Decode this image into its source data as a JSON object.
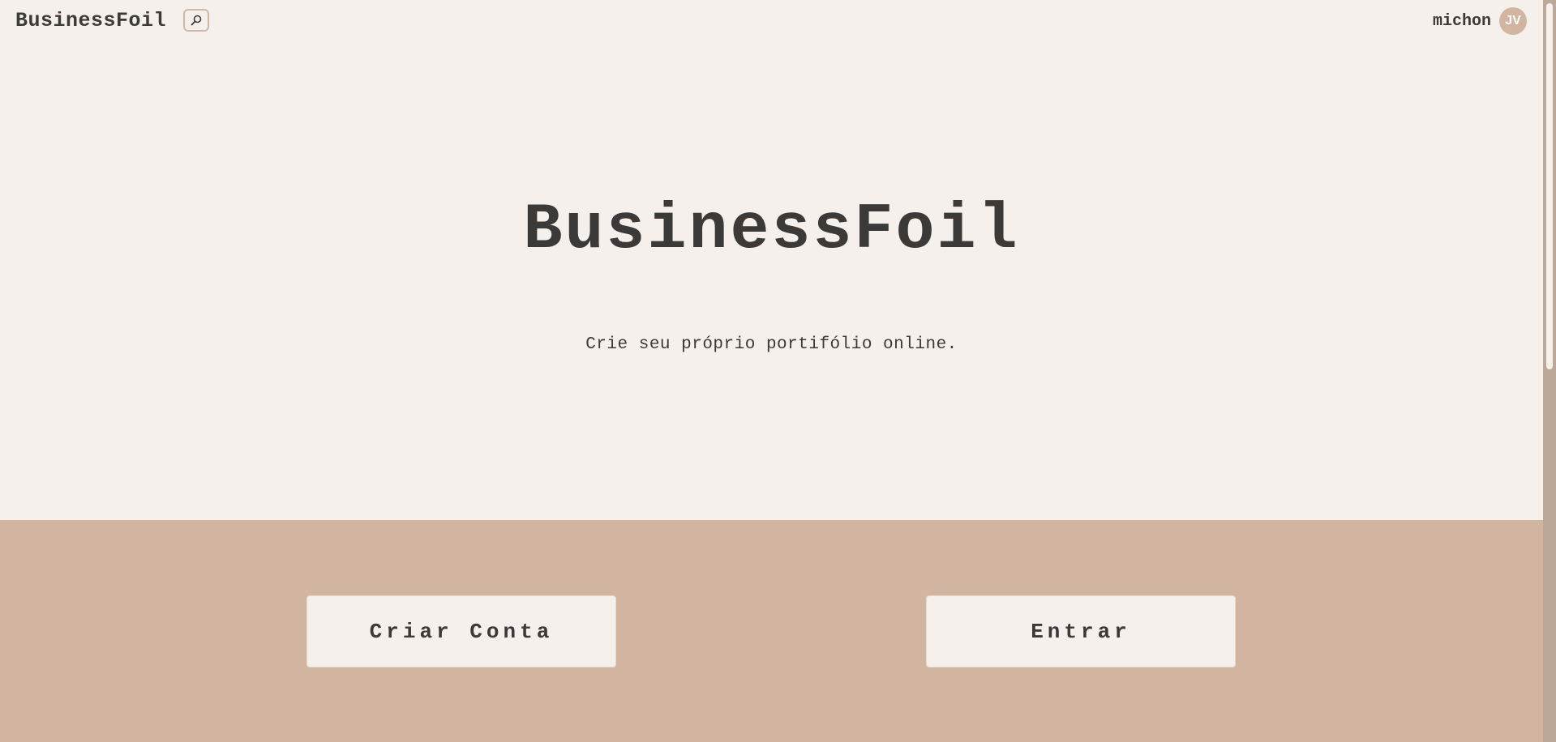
{
  "header": {
    "brand": "BusinessFoil",
    "search_icon": "search-icon",
    "username": "michon",
    "avatar_initials": "JV"
  },
  "hero": {
    "title": "BusinessFoil",
    "subtitle": "Crie seu próprio portifólio online."
  },
  "actions": {
    "create_account_label": "Criar Conta",
    "login_label": "Entrar"
  },
  "colors": {
    "background": "#f5f0ec",
    "accent": "#d2b5a1",
    "text": "#3b3a38"
  }
}
